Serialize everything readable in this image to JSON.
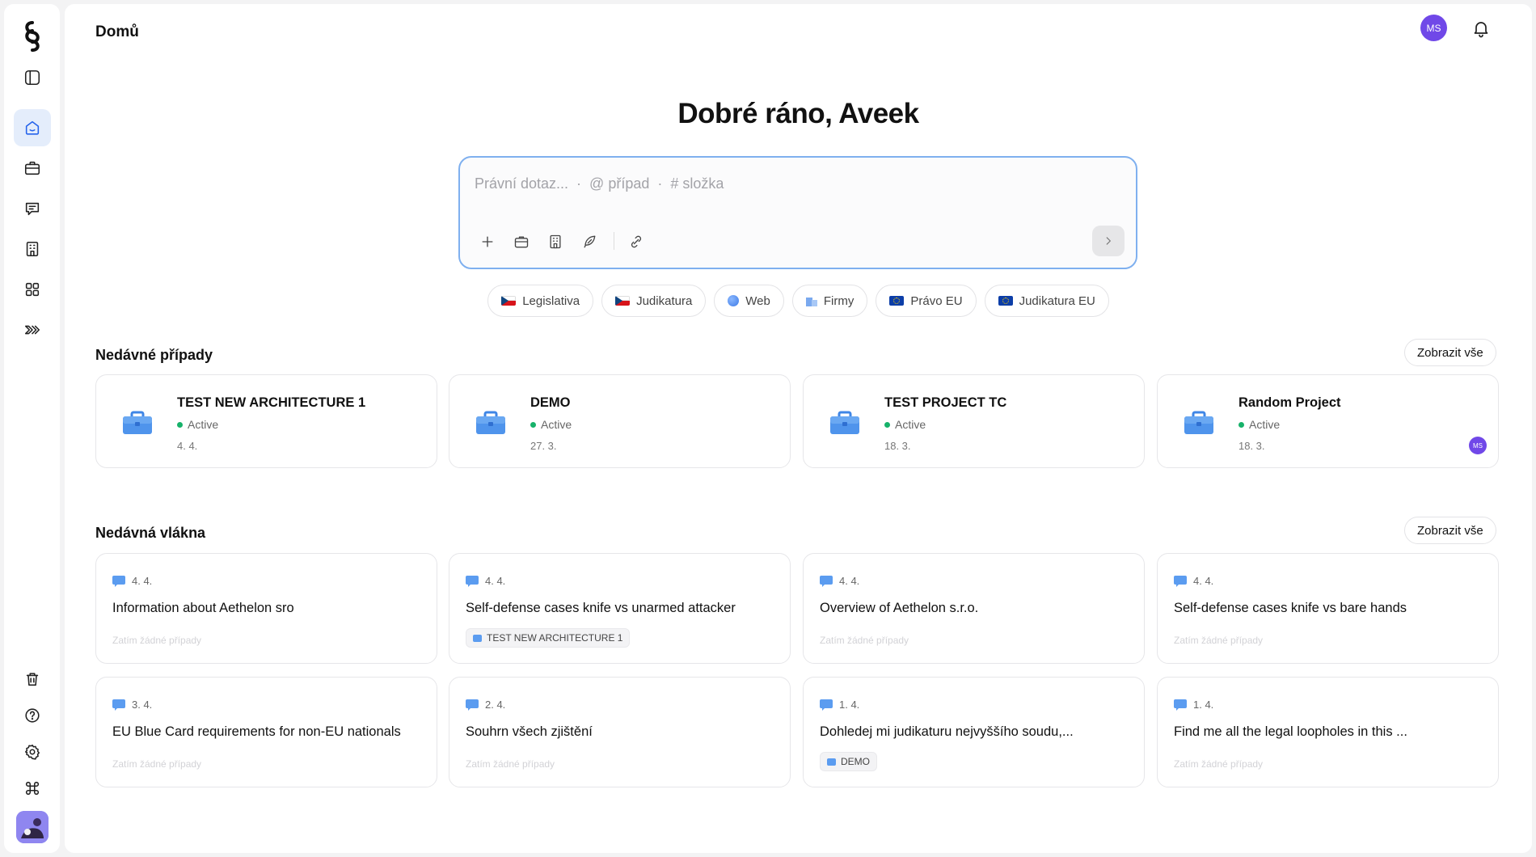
{
  "sidebar": {
    "items": [
      {
        "name": "sidebar-toggle",
        "icon": "sidebar-icon",
        "active": false
      },
      {
        "name": "sidebar-item-home",
        "icon": "home-icon",
        "active": true
      },
      {
        "name": "sidebar-item-cases",
        "icon": "briefcase-icon",
        "active": false
      },
      {
        "name": "sidebar-item-chats",
        "icon": "chat-icon",
        "active": false
      },
      {
        "name": "sidebar-item-directory",
        "icon": "building-icon",
        "active": false
      },
      {
        "name": "sidebar-item-apps",
        "icon": "grid-icon",
        "active": false
      },
      {
        "name": "sidebar-item-workflows",
        "icon": "workflow-icon",
        "active": false
      }
    ],
    "bottom": [
      "trash-icon",
      "help-icon",
      "gear-icon",
      "command-icon"
    ]
  },
  "header": {
    "title": "Domů",
    "avatar_initials": "MS"
  },
  "greeting": "Dobré ráno, Aveek",
  "composer": {
    "placeholder": "Právní dotaz...  ·  @ případ  ·  # složka"
  },
  "sources": [
    {
      "label": "Legislativa",
      "icon": "flag-cz"
    },
    {
      "label": "Judikatura",
      "icon": "flag-cz"
    },
    {
      "label": "Web",
      "icon": "globe-icon"
    },
    {
      "label": "Firmy",
      "icon": "building-icon"
    },
    {
      "label": "Právo EU",
      "icon": "flag-eu"
    },
    {
      "label": "Judikatura EU",
      "icon": "flag-eu"
    }
  ],
  "recent_cases": {
    "title": "Nedávné případy",
    "view_all": "Zobrazit vše",
    "items": [
      {
        "name": "TEST NEW ARCHITECTURE 1",
        "status": "Active",
        "date": "4. 4."
      },
      {
        "name": "DEMO",
        "status": "Active",
        "date": "27. 3."
      },
      {
        "name": "TEST PROJECT TC",
        "status": "Active",
        "date": "18. 3."
      },
      {
        "name": "Random Project",
        "status": "Active",
        "date": "18. 3.",
        "avatar": "MS"
      }
    ]
  },
  "recent_threads": {
    "title": "Nedávná vlákna",
    "view_all": "Zobrazit vše",
    "empty_text": "Zatím žádné případy",
    "items": [
      {
        "date": "4. 4.",
        "title": "Information about Aethelon sro",
        "tag": ""
      },
      {
        "date": "4. 4.",
        "title": "Self-defense cases knife vs unarmed attacker",
        "tag": "TEST NEW ARCHITECTURE 1"
      },
      {
        "date": "4. 4.",
        "title": "Overview of Aethelon s.r.o.",
        "tag": ""
      },
      {
        "date": "4. 4.",
        "title": "Self-defense cases knife vs bare hands",
        "tag": ""
      },
      {
        "date": "3. 4.",
        "title": "EU Blue Card requirements for non-EU nationals",
        "tag": ""
      },
      {
        "date": "2. 4.",
        "title": "Souhrn všech zjištění",
        "tag": ""
      },
      {
        "date": "1. 4.",
        "title": "Dohledej mi judikaturu nejvyššího soudu,...",
        "tag": "DEMO"
      },
      {
        "date": "1. 4.",
        "title": "Find me all the legal loopholes in this ...",
        "tag": ""
      }
    ]
  },
  "colors": {
    "accent": "#2563eb",
    "active_nav_bg": "#e4edfb",
    "status_active": "#17b26a",
    "avatar": "#7048e8"
  }
}
